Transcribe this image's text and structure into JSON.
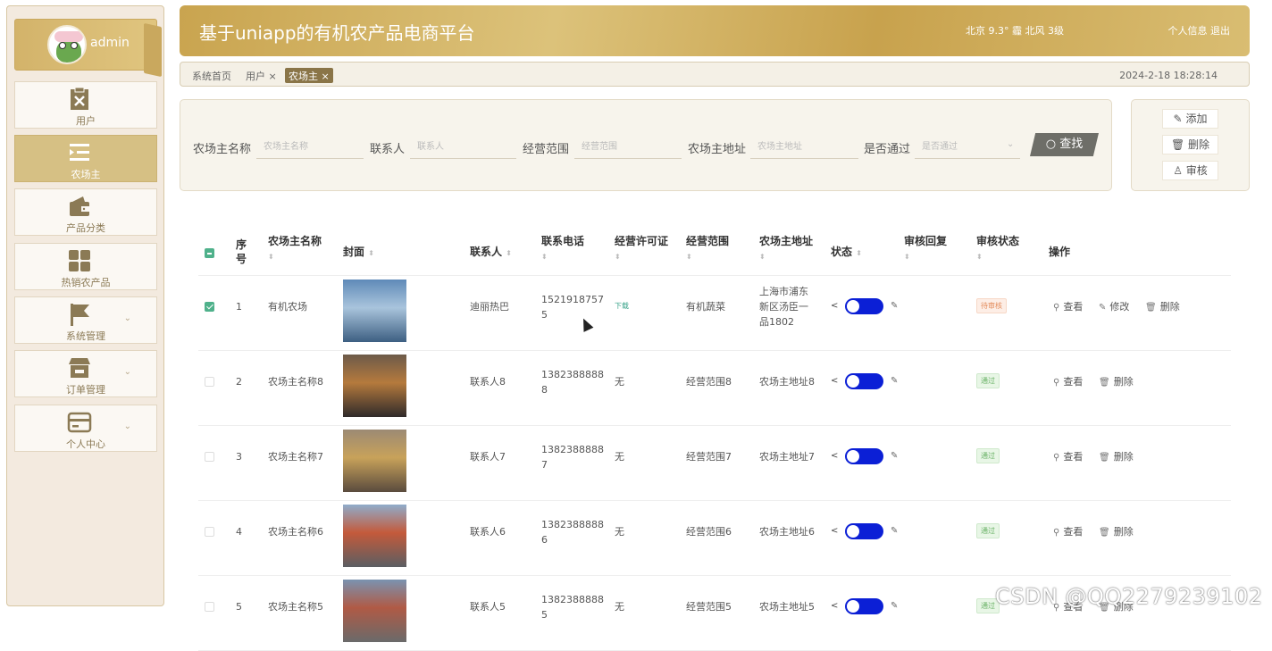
{
  "sidebar": {
    "user": {
      "name": "admin"
    },
    "items": [
      {
        "label": "用户",
        "icon": "clipboard-x-icon",
        "active": false
      },
      {
        "label": "农场主",
        "icon": "list-indent-icon",
        "active": true
      },
      {
        "label": "产品分类",
        "icon": "wallet-icon",
        "active": false
      },
      {
        "label": "热销农产品",
        "icon": "grid-icon",
        "active": false
      },
      {
        "label": "系统管理",
        "icon": "flag-icon",
        "active": false
      },
      {
        "label": "订单管理",
        "icon": "store-icon",
        "active": false
      },
      {
        "label": "个人中心",
        "icon": "card-icon",
        "active": false
      }
    ]
  },
  "header": {
    "title": "基于uniapp的有机农产品电商平台",
    "weather": "北京  9.3°  霾  北风  3级",
    "profile_link": "个人信息",
    "logout_link": "退出"
  },
  "breadcrumb": {
    "items": [
      "系统首页",
      "用户 ×",
      "农场主 ×"
    ],
    "datetime": "2024-2-18 18:28:14"
  },
  "search": {
    "fields": [
      {
        "label": "农场主名称",
        "placeholder": "农场主名称"
      },
      {
        "label": "联系人",
        "placeholder": "联系人"
      },
      {
        "label": "经营范围",
        "placeholder": "经营范围"
      },
      {
        "label": "农场主地址",
        "placeholder": "农场主地址"
      },
      {
        "label": "是否通过",
        "placeholder": "是否通过"
      }
    ],
    "find_label": "查找"
  },
  "actions": {
    "add": "添加",
    "delete": "删除",
    "review": "审核"
  },
  "table": {
    "columns": [
      "序号",
      "农场主名称",
      "封面",
      "联系人",
      "联系电话",
      "经营许可证",
      "经营范围",
      "农场主地址",
      "状态",
      "审核回复",
      "审核状态",
      "操作"
    ],
    "ops": {
      "view": "查看",
      "edit": "修改",
      "delete": "删除"
    },
    "rows": [
      {
        "index": "1",
        "name": "有机农场",
        "contact": "迪丽热巴",
        "phone": "15219187575",
        "license": "下载",
        "scope": "有机蔬菜",
        "address": "上海市浦东新区汤臣一品1802",
        "status_on": true,
        "review_status": "待审核",
        "checked": true,
        "cover_colors": [
          "#5f8ab8",
          "#a9c4dc",
          "#3d5f82"
        ]
      },
      {
        "index": "2",
        "name": "农场主名称8",
        "contact": "联系人8",
        "phone": "13823888888",
        "license": "无",
        "scope": "经营范围8",
        "address": "农场主地址8",
        "status_on": true,
        "review_status": "通过",
        "checked": false,
        "cover_colors": [
          "#6d5a4a",
          "#b57a3d",
          "#2f2a2a"
        ]
      },
      {
        "index": "3",
        "name": "农场主名称7",
        "contact": "联系人7",
        "phone": "13823888887",
        "license": "无",
        "scope": "经营范围7",
        "address": "农场主地址7",
        "status_on": true,
        "review_status": "通过",
        "checked": false,
        "cover_colors": [
          "#9c8a74",
          "#c8a25a",
          "#5a4b3e"
        ]
      },
      {
        "index": "4",
        "name": "农场主名称6",
        "contact": "联系人6",
        "phone": "13823888886",
        "license": "无",
        "scope": "经营范围6",
        "address": "农场主地址6",
        "status_on": true,
        "review_status": "通过",
        "checked": false,
        "cover_colors": [
          "#8faccb",
          "#c45a3b",
          "#5b5e62"
        ]
      },
      {
        "index": "5",
        "name": "农场主名称5",
        "contact": "联系人5",
        "phone": "13823888885",
        "license": "无",
        "scope": "经营范围5",
        "address": "农场主地址5",
        "status_on": true,
        "review_status": "通过",
        "checked": false,
        "cover_colors": [
          "#7a93b0",
          "#b05a45",
          "#6a6a6a"
        ]
      }
    ]
  },
  "watermark": "CSDN @QQ2279239102"
}
